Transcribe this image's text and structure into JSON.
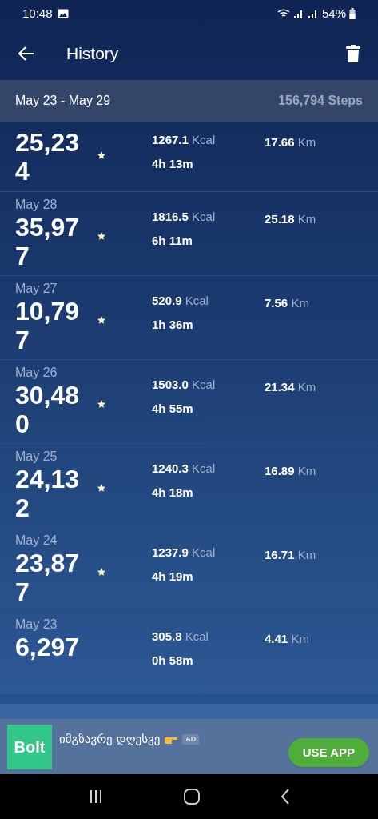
{
  "status_bar": {
    "time": "10:48",
    "battery": "54%"
  },
  "app_bar": {
    "title": "History"
  },
  "week": {
    "range": "May 23 - May 29",
    "total": "156,794 Steps"
  },
  "days": [
    {
      "steps": "25,234",
      "starred": true,
      "kcal": "1267.1",
      "kcal_unit": "Kcal",
      "duration": "4h 13m",
      "km": "17.66",
      "km_unit": "Km"
    },
    {
      "date": "May 28",
      "steps": "35,977",
      "starred": true,
      "kcal": "1816.5",
      "kcal_unit": "Kcal",
      "duration": "6h 11m",
      "km": "25.18",
      "km_unit": "Km"
    },
    {
      "date": "May 27",
      "steps": "10,797",
      "starred": true,
      "kcal": "520.9",
      "kcal_unit": "Kcal",
      "duration": "1h 36m",
      "km": "7.56",
      "km_unit": "Km"
    },
    {
      "date": "May 26",
      "steps": "30,480",
      "starred": true,
      "kcal": "1503.0",
      "kcal_unit": "Kcal",
      "duration": "4h 55m",
      "km": "21.34",
      "km_unit": "Km"
    },
    {
      "date": "May 25",
      "steps": "24,132",
      "starred": true,
      "kcal": "1240.3",
      "kcal_unit": "Kcal",
      "duration": "4h 18m",
      "km": "16.89",
      "km_unit": "Km"
    },
    {
      "date": "May 24",
      "steps": "23,877",
      "starred": true,
      "kcal": "1237.9",
      "kcal_unit": "Kcal",
      "duration": "4h 19m",
      "km": "16.71",
      "km_unit": "Km"
    },
    {
      "date": "May 23",
      "steps": "6,297",
      "starred": false,
      "kcal": "305.8",
      "kcal_unit": "Kcal",
      "duration": "0h 58m",
      "km": "4.41",
      "km_unit": "Km"
    }
  ],
  "ad": {
    "logo": "Bolt",
    "text": "იმგზავრე დღესვე",
    "badge": "AD",
    "button": "USE APP"
  }
}
